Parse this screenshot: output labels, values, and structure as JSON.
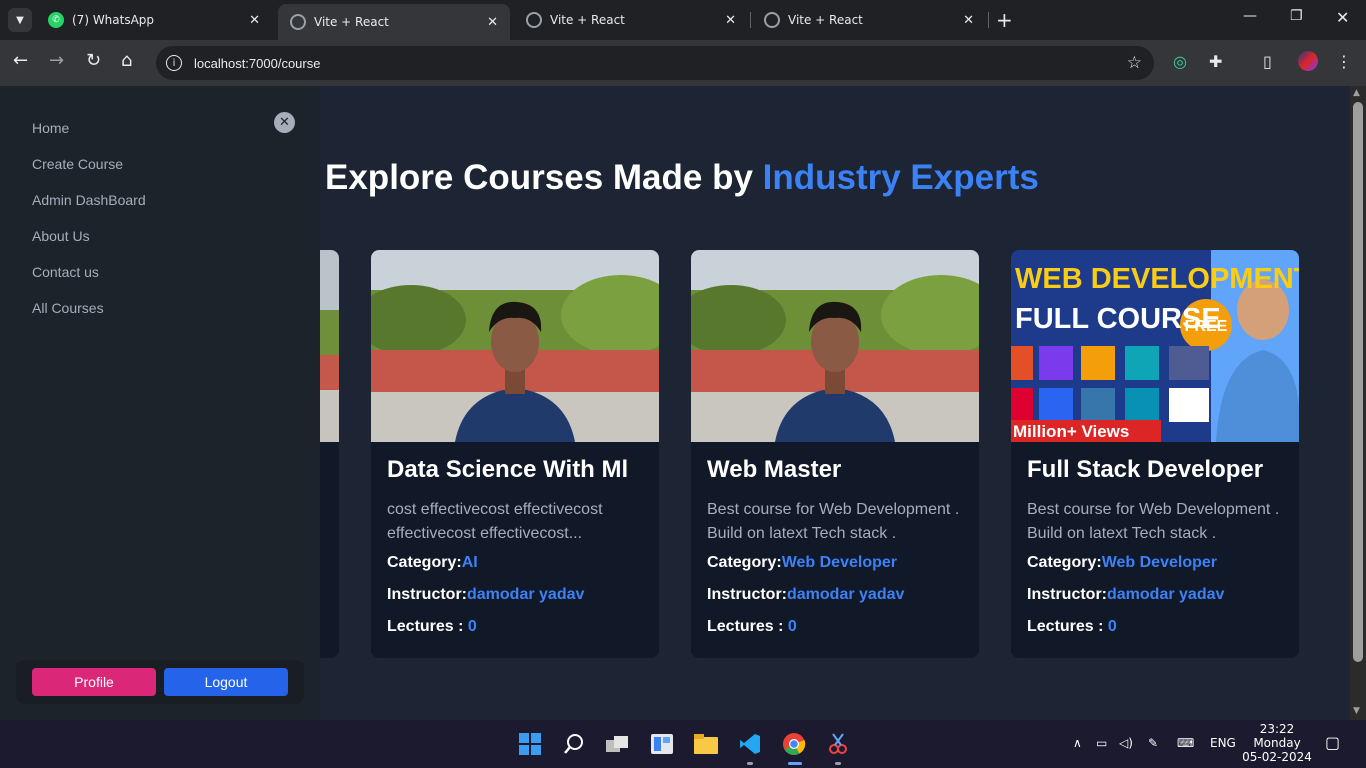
{
  "browser": {
    "tabs": [
      {
        "title": "(7) WhatsApp",
        "badge": "7"
      },
      {
        "title": "Vite + React"
      },
      {
        "title": "Vite + React"
      },
      {
        "title": "Vite + React"
      }
    ],
    "url": "localhost:7000/course"
  },
  "sidebar": {
    "items": [
      {
        "label": "Home"
      },
      {
        "label": "Create Course"
      },
      {
        "label": "Admin DashBoard"
      },
      {
        "label": "About Us"
      },
      {
        "label": "Contact us"
      },
      {
        "label": "All Courses"
      }
    ],
    "profile_label": "Profile",
    "logout_label": "Logout"
  },
  "main": {
    "heading_prefix": "Explore Courses Made by ",
    "heading_accent": "Industry Experts",
    "category_label": "Category:",
    "instructor_label": "Instructor:",
    "lectures_label": "Lectures : ",
    "courses": [
      {
        "title": "Data Science With Ml",
        "description": "cost effectivecost effectivecost effectivecost effectivecost...",
        "category": "AI",
        "instructor": "damodar yadav",
        "lectures": "0"
      },
      {
        "title": "Web Master",
        "description": "Best course for Web Development . Build on latext Tech stack . NodeJs...",
        "category": "Web Developer",
        "instructor": "damodar yadav",
        "lectures": "0"
      },
      {
        "title": "Full Stack Developer",
        "description": "Best course for Web Development . Build on latext Tech stack . NodeJs...",
        "category": "Web Developer",
        "instructor": "damodar yadav",
        "lectures": "0",
        "thumbnail_text": [
          "WEB DEVELOPMENT",
          "FULL COURSE",
          "FREE",
          "Million+ Views"
        ]
      }
    ]
  },
  "taskbar": {
    "lang": "ENG",
    "time": "23:22",
    "day": "Monday",
    "date": "05-02-2024"
  },
  "colors": {
    "accent": "#3b82f6",
    "profile": "#db2777",
    "logout": "#2563eb",
    "page_bg": "#1d2433",
    "card_bg": "#111827"
  }
}
